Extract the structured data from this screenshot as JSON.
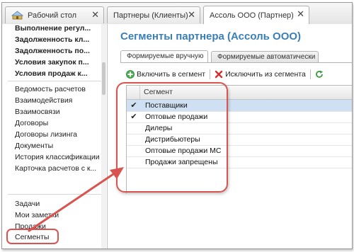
{
  "tabs": [
    {
      "label": "Рабочий стол",
      "icon": "home-icon"
    },
    {
      "label": "Партнеры (Клиенты)"
    },
    {
      "label": "Ассоль ООО (Партнер)"
    }
  ],
  "close_glyph": "✕",
  "sidebar": {
    "bold_items": [
      "Выполнение регул...",
      "Задолженность кл...",
      "Задолженность по...",
      "Условия закупок п...",
      "Условия продаж к..."
    ],
    "items": [
      "Ведомость расчетов",
      "Взаимодействия",
      "Взаимосвязи",
      "Договоры",
      "Договоры лизинга",
      "Документы",
      "История классификации",
      "Карточка расчетов с к..."
    ],
    "bottom_items": [
      "Задачи",
      "Мои заметки",
      "Продажи",
      "Сегменты"
    ]
  },
  "main": {
    "title": "Сегменты партнера (Ассоль ООО)",
    "subtabs": [
      "Формируемые вручную",
      "Формируемые автоматически"
    ],
    "toolbar": {
      "include_label": "Включить в сегмент",
      "exclude_label": "Исключить из сегмента"
    },
    "table": {
      "header": "Сегмент",
      "rows": [
        {
          "name": "Поставщики",
          "checked": true,
          "selected": true
        },
        {
          "name": "Оптовые продажи",
          "checked": true,
          "selected": false
        },
        {
          "name": "Дилеры",
          "checked": false,
          "selected": false
        },
        {
          "name": "Дистрибьютеры",
          "checked": false,
          "selected": false
        },
        {
          "name": "Оптовые продажи МС",
          "checked": false,
          "selected": false
        },
        {
          "name": "Продажи запрещены",
          "checked": false,
          "selected": false
        }
      ]
    }
  },
  "colors": {
    "title": "#3a7fb4",
    "highlight": "#d9534f",
    "selected_row": "#cfe0f3"
  }
}
